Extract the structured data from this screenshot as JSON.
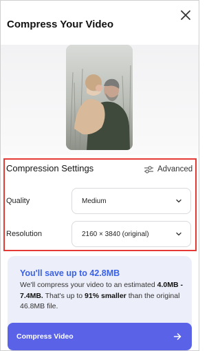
{
  "dialog": {
    "title": "Compress Your Video",
    "close_icon": "close-icon"
  },
  "preview": {
    "thumbnail_icon": "video-thumbnail"
  },
  "settings": {
    "title": "Compression Settings",
    "advanced_label": "Advanced",
    "advanced_icon": "sliders-icon",
    "quality": {
      "label": "Quality",
      "value": "Medium"
    },
    "resolution": {
      "label": "Resolution",
      "value": "2160 × 3840 (original)"
    }
  },
  "savings": {
    "title": "You'll save up to 42.8MB",
    "text_1": "We'll compress your video to an estimated",
    "range": "4.0MB - 7.4MB.",
    "text_2": "That's up to",
    "percent": "91% smaller",
    "text_3": "than the original 46.8MB file."
  },
  "action": {
    "label": "Compress Video",
    "icon": "arrow-right-icon"
  },
  "colors": {
    "accent": "#5a63e8",
    "highlight": "#e53935",
    "info_title": "#3a62e6",
    "card_bg": "#eceef9"
  }
}
